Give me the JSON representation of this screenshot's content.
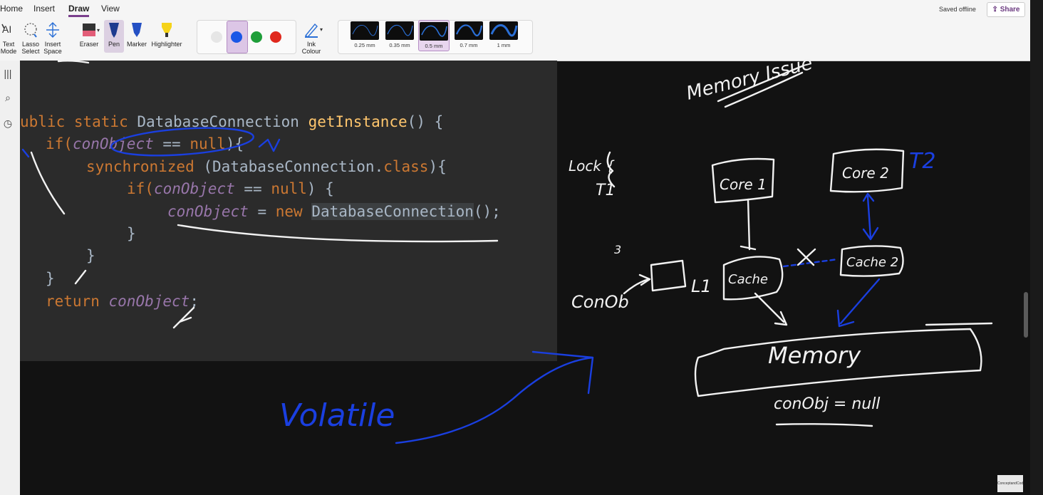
{
  "menu": {
    "home": "Home",
    "insert": "Insert",
    "draw": "Draw",
    "view": "View"
  },
  "tools": {
    "text_mode": "Text Mode",
    "lasso_select": "Lasso Select",
    "insert_space": "Insert Space",
    "eraser": "Eraser",
    "pen": "Pen",
    "marker": "Marker",
    "highlighter": "Highlighter",
    "ink_colour": "Ink Colour"
  },
  "colors": {
    "white": "#e6e6e6",
    "blue": "#1a56e6",
    "green": "#1f9e3a",
    "red": "#e0281d",
    "accent": "#7a3f8c"
  },
  "thickness": [
    "0.25 mm",
    "0.35 mm",
    "0.5 mm",
    "0.7 mm",
    "1 mm"
  ],
  "thickness_selected": "0.5 mm",
  "status": {
    "saved": "Saved offline",
    "share": "Share"
  },
  "code": {
    "l1": [
      "ublic ",
      "static ",
      "DatabaseConnection ",
      "getInstance",
      "() {"
    ],
    "l2": [
      "if(",
      "conObject",
      " == ",
      "null",
      "){"
    ],
    "l3": [
      "synchronized",
      " (DatabaseConnection.",
      "class",
      "){"
    ],
    "l4": [
      "if(",
      "conObject",
      " == ",
      "null",
      ") {"
    ],
    "l5": [
      "conObject",
      " = ",
      "new ",
      "DatabaseConnection",
      "();"
    ],
    "l6": "}",
    "l7": "}",
    "l8": "}",
    "l9": [
      "return ",
      "conObject",
      ";"
    ]
  },
  "ink": {
    "volatile": "Volatile",
    "memory_issue": "Memory Issue",
    "lock": "Lock {",
    "t1": "T1",
    "t2": "T2",
    "core1": "Core 1",
    "core2": "Core 2",
    "cache1": "Cache",
    "cache2": "Cache 2",
    "l1": "L1",
    "memory": "Memory",
    "conobj": "conObj = null",
    "conob": "ConOb",
    "three": "3"
  },
  "watermark": "ConceptandCoding"
}
